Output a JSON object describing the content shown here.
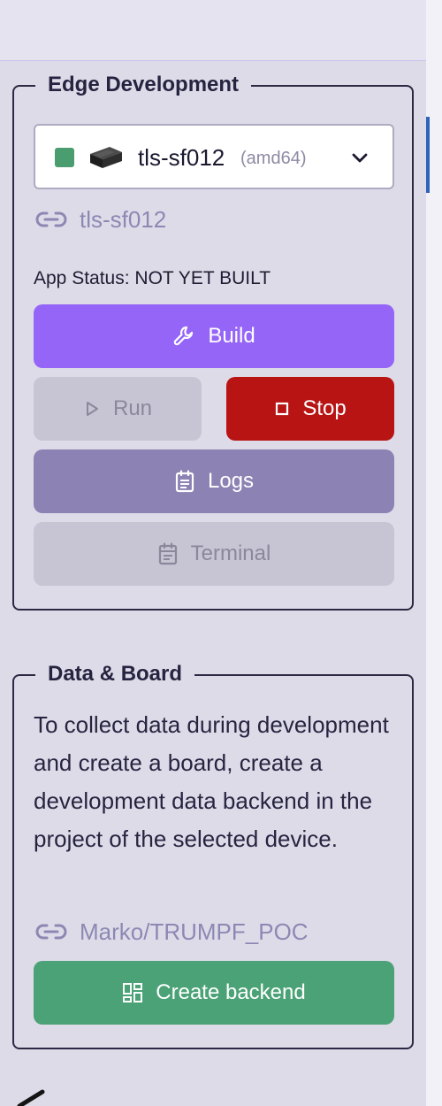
{
  "edge_development": {
    "title": "Edge Development",
    "device_select": {
      "status_color": "#4a9d6f",
      "device_icon": "device-box-icon",
      "name": "tls-sf012",
      "arch": "(amd64)",
      "dropdown_icon": "chevron-down-icon"
    },
    "device_link": {
      "icon": "link-icon",
      "text": "tls-sf012"
    },
    "app_status": "App Status: NOT YET BUILT",
    "buttons": {
      "build": {
        "label": "Build",
        "icon": "wrench-icon",
        "color": "#9465f7"
      },
      "run": {
        "label": "Run",
        "icon": "play-icon",
        "disabled": true
      },
      "stop": {
        "label": "Stop",
        "icon": "stop-icon",
        "color": "#b81414"
      },
      "logs": {
        "label": "Logs",
        "icon": "clipboard-icon",
        "color": "#8c82b3"
      },
      "terminal": {
        "label": "Terminal",
        "icon": "calendar-icon",
        "disabled": true
      }
    }
  },
  "data_board": {
    "title": "Data & Board",
    "description": "To collect data during development and create a board, create a development data backend in the project of the selected device.",
    "project_link": {
      "icon": "link-icon",
      "text": "Marko/TRUMPF_POC"
    },
    "create_button": {
      "label": "Create backend",
      "icon": "dashboard-icon",
      "color": "#4aa276"
    }
  }
}
